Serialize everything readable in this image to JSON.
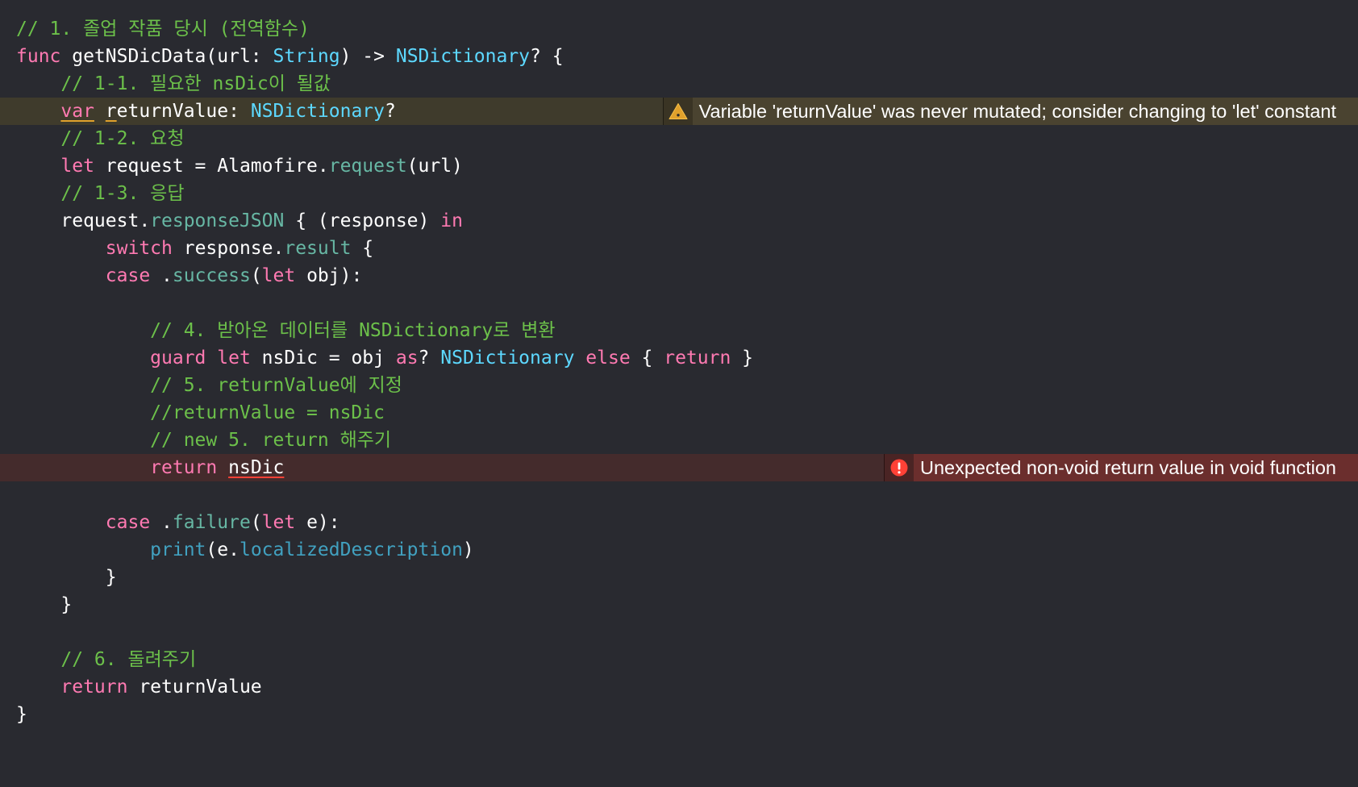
{
  "editor": {
    "lines": [
      [
        {
          "t": "// 1. 졸업 작품 당시 (전역함수)",
          "c": "cm"
        }
      ],
      [
        {
          "t": "func",
          "c": "kw"
        },
        {
          "t": " getNSDicData(url: ",
          "c": "pl"
        },
        {
          "t": "String",
          "c": "typ"
        },
        {
          "t": ") -> ",
          "c": "pl"
        },
        {
          "t": "NSDictionary",
          "c": "typ"
        },
        {
          "t": "? {",
          "c": "pl"
        }
      ],
      [
        {
          "t": "    // 1-1. 필요한 nsDic이 될값",
          "c": "cm"
        }
      ],
      [
        {
          "t": "    ",
          "c": "pl"
        },
        {
          "t": "var",
          "c": "kw sq-warn"
        },
        {
          "t": " ",
          "c": "pl"
        },
        {
          "t": "r",
          "c": "pl sq-warn"
        },
        {
          "t": "eturnValue: ",
          "c": "pl"
        },
        {
          "t": "NSDictionary",
          "c": "typ"
        },
        {
          "t": "?",
          "c": "pl"
        }
      ],
      [
        {
          "t": "    // 1-2. 요청",
          "c": "cm"
        }
      ],
      [
        {
          "t": "    ",
          "c": "pl"
        },
        {
          "t": "let",
          "c": "kw"
        },
        {
          "t": " request = Alamofire.",
          "c": "pl"
        },
        {
          "t": "request",
          "c": "fn"
        },
        {
          "t": "(url)",
          "c": "pl"
        }
      ],
      [
        {
          "t": "    // 1-3. 응답",
          "c": "cm"
        }
      ],
      [
        {
          "t": "    request.",
          "c": "pl"
        },
        {
          "t": "responseJSON",
          "c": "fn"
        },
        {
          "t": " { (response) ",
          "c": "pl"
        },
        {
          "t": "in",
          "c": "kw"
        }
      ],
      [
        {
          "t": "        ",
          "c": "pl"
        },
        {
          "t": "switch",
          "c": "kw"
        },
        {
          "t": " response.",
          "c": "pl"
        },
        {
          "t": "result",
          "c": "fn"
        },
        {
          "t": " {",
          "c": "pl"
        }
      ],
      [
        {
          "t": "        ",
          "c": "pl"
        },
        {
          "t": "case",
          "c": "kw"
        },
        {
          "t": " .",
          "c": "pl"
        },
        {
          "t": "success",
          "c": "fn"
        },
        {
          "t": "(",
          "c": "pl"
        },
        {
          "t": "let",
          "c": "kw"
        },
        {
          "t": " obj):",
          "c": "pl"
        }
      ],
      [],
      [
        {
          "t": "            // 4. 받아온 데이터를 NSDictionary로 변환",
          "c": "cm"
        }
      ],
      [
        {
          "t": "            ",
          "c": "pl"
        },
        {
          "t": "guard",
          "c": "kw"
        },
        {
          "t": " ",
          "c": "pl"
        },
        {
          "t": "let",
          "c": "kw"
        },
        {
          "t": " nsDic = obj ",
          "c": "pl"
        },
        {
          "t": "as",
          "c": "kw"
        },
        {
          "t": "? ",
          "c": "pl"
        },
        {
          "t": "NSDictionary",
          "c": "typ"
        },
        {
          "t": " ",
          "c": "pl"
        },
        {
          "t": "else",
          "c": "kw"
        },
        {
          "t": " { ",
          "c": "pl"
        },
        {
          "t": "return",
          "c": "kw"
        },
        {
          "t": " }",
          "c": "pl"
        }
      ],
      [
        {
          "t": "            // 5. returnValue에 지정",
          "c": "cm"
        }
      ],
      [
        {
          "t": "            //returnValue = nsDic",
          "c": "cm"
        }
      ],
      [
        {
          "t": "            // new 5. return 해주기",
          "c": "cm"
        }
      ],
      [
        {
          "t": "            ",
          "c": "pl"
        },
        {
          "t": "return",
          "c": "kw"
        },
        {
          "t": " ",
          "c": "pl"
        },
        {
          "t": "nsDic",
          "c": "pl sq-err"
        }
      ],
      [],
      [
        {
          "t": "        ",
          "c": "pl"
        },
        {
          "t": "case",
          "c": "kw"
        },
        {
          "t": " .",
          "c": "pl"
        },
        {
          "t": "failure",
          "c": "fn"
        },
        {
          "t": "(",
          "c": "pl"
        },
        {
          "t": "let",
          "c": "kw"
        },
        {
          "t": " e):",
          "c": "pl"
        }
      ],
      [
        {
          "t": "            ",
          "c": "pl"
        },
        {
          "t": "print",
          "c": "sys"
        },
        {
          "t": "(e.",
          "c": "pl"
        },
        {
          "t": "localizedDescription",
          "c": "sys"
        },
        {
          "t": ")",
          "c": "pl"
        }
      ],
      [
        {
          "t": "        }",
          "c": "pl"
        }
      ],
      [
        {
          "t": "    }",
          "c": "pl"
        }
      ],
      [],
      [
        {
          "t": "    // 6. 돌려주기",
          "c": "cm"
        }
      ],
      [
        {
          "t": "    ",
          "c": "pl"
        },
        {
          "t": "return",
          "c": "kw"
        },
        {
          "t": " returnValue",
          "c": "pl"
        }
      ],
      [
        {
          "t": "}",
          "c": "pl"
        }
      ]
    ]
  },
  "issues": [
    {
      "line_index": 3,
      "kind": "warning",
      "icon": "warning-icon",
      "message": "Variable 'returnValue' was never mutated; consider changing to 'let' constant"
    },
    {
      "line_index": 16,
      "kind": "error",
      "icon": "error-icon",
      "message": "Unexpected non-void return value in void function"
    }
  ],
  "colors": {
    "background": "#292a30",
    "comment": "#6cc04a",
    "keyword": "#ff7ab2",
    "type": "#5dd8ff",
    "member": "#67b7a4",
    "system": "#41a1c0",
    "plain": "#ffffff",
    "warning_accent": "#e0a12c",
    "error_accent": "#ff4136"
  }
}
